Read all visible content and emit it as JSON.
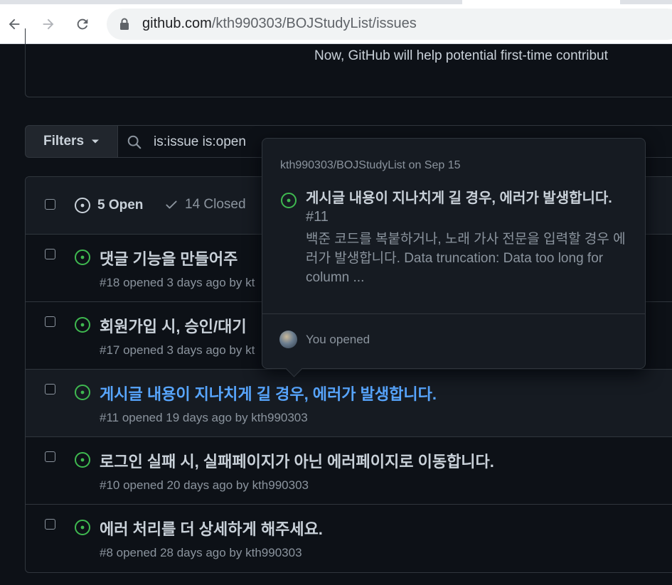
{
  "browser": {
    "url_host": "github.com",
    "url_path": "/kth990303/BOJStudyList/issues"
  },
  "banner": {
    "text": "Now, GitHub will help potential first-time contribut"
  },
  "toolbar": {
    "filters_label": "Filters",
    "search_value": "is:issue is:open"
  },
  "list_header": {
    "open_label": "5 Open",
    "closed_label": "14 Closed"
  },
  "issues": [
    {
      "title": "댓글 기능을 만들어주",
      "meta": "#18 opened 3 days ago by kt"
    },
    {
      "title": "회원가입 시, 승인/대기",
      "meta": "#17 opened 3 days ago by kt"
    },
    {
      "title": "게시글 내용이 지나치게 길 경우, 에러가 발생합니다.",
      "meta": "#11 opened 19 days ago by kth990303"
    },
    {
      "title": "로그인 실패 시, 실패페이지가 아닌 에러페이지로 이동합니다.",
      "meta": "#10 opened 20 days ago by kth990303"
    },
    {
      "title": "에러 처리를 더 상세하게 해주세요.",
      "meta": "#8 opened 28 days ago by kth990303"
    }
  ],
  "hovercard": {
    "repo_line": "kth990303/BOJStudyList on Sep 15",
    "title": "게시글 내용이 지나치게 길 경우, 에러가 발생합니다.",
    "number": "#11",
    "body": "백준 코드를 복붙하거나, 노래 가사 전문을 입력할 경우 에러가 발생합니다. Data truncation: Data too long for column ...",
    "footer": "You opened"
  },
  "colors": {
    "open_green": "#3fb950",
    "link_blue": "#58a6ff",
    "background": "#0d1117"
  }
}
